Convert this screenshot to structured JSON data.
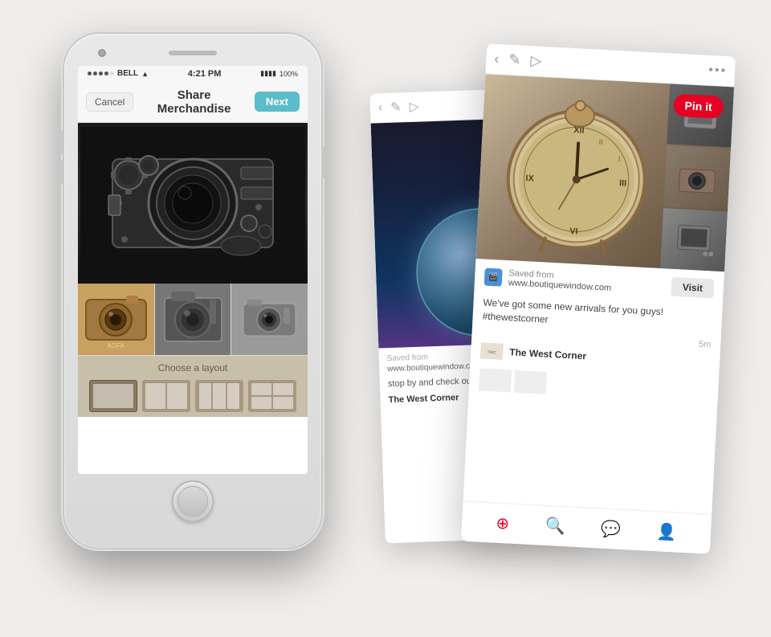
{
  "phone": {
    "status": {
      "carrier": "BELL",
      "time": "4:21 PM",
      "battery": "100%",
      "wifi": true
    },
    "nav": {
      "cancel_label": "Cancel",
      "title": "Share Merchandise",
      "next_label": "Next"
    },
    "layout": {
      "label": "Choose a layout"
    }
  },
  "pinterest": {
    "pin_it_label": "Pin it",
    "saved_from_label": "Saved from",
    "source_url": "www.boutiquewindow.com",
    "description": "We've got some new arrivals for you guys! #thewestcorner",
    "time": "5m",
    "brand_name": "The West Corner",
    "visit_label": "Visit"
  },
  "globe_card": {
    "saved_from_label": "Saved from",
    "source_url": "www.boutiquewindow.com",
    "description": "stop by and check out our new anti...",
    "brand_name": "The West Corner"
  }
}
